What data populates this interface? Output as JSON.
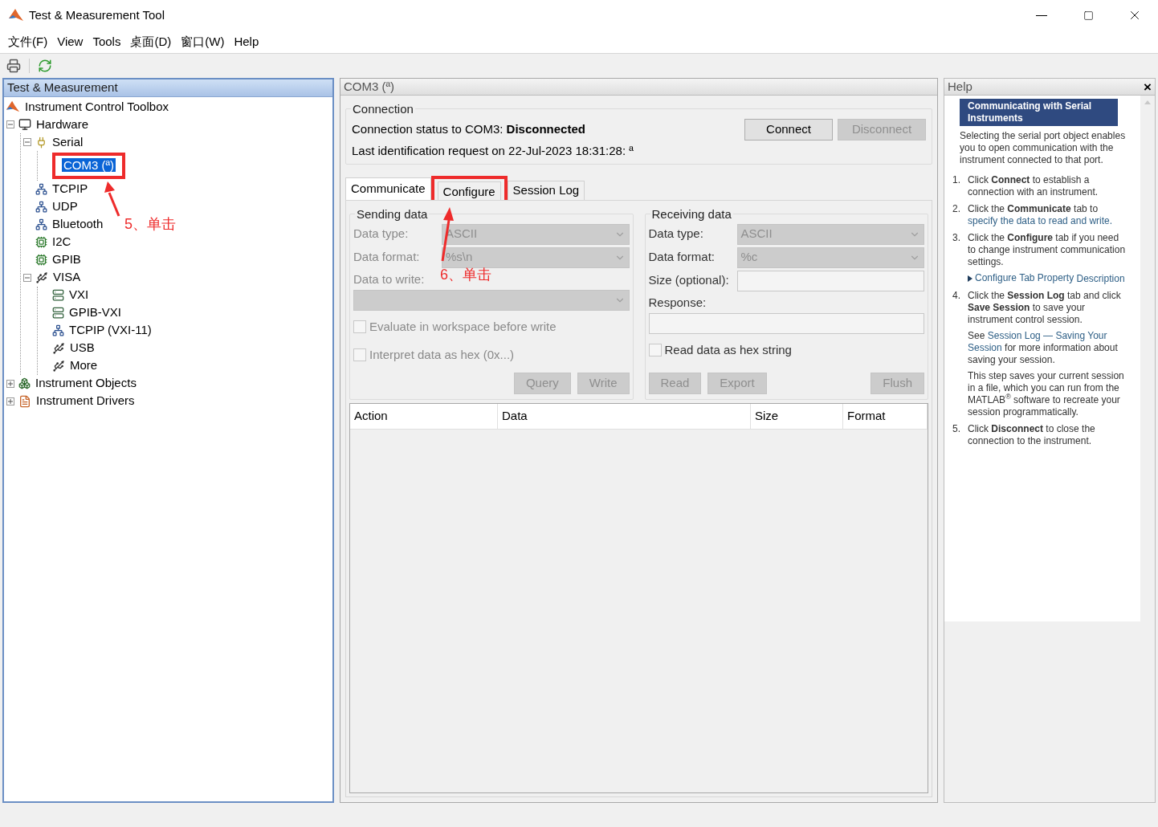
{
  "window": {
    "title": "Test & Measurement Tool"
  },
  "menu": [
    "文件(F)",
    "View",
    "Tools",
    "桌面(D)",
    "窗口(W)",
    "Help"
  ],
  "tree_panel": {
    "title": "Test & Measurement",
    "items": [
      {
        "label": "Instrument Control Toolbox",
        "kind": "toolbox",
        "selected": false,
        "children": [
          {
            "label": "Hardware",
            "kind": "hardware",
            "expanded": true,
            "selected": false,
            "children": [
              {
                "label": "Serial",
                "kind": "serial",
                "expanded": true,
                "selected": false,
                "children": [
                  {
                    "label": "COM3 (ª)",
                    "kind": "port",
                    "selected": true,
                    "highlighted": true
                  }
                ]
              },
              {
                "label": "TCPIP",
                "kind": "network",
                "selected": false
              },
              {
                "label": "UDP",
                "kind": "network",
                "selected": false
              },
              {
                "label": "Bluetooth",
                "kind": "network",
                "selected": false
              },
              {
                "label": "I2C",
                "kind": "board",
                "selected": false
              },
              {
                "label": "GPIB",
                "kind": "board",
                "selected": false
              },
              {
                "label": "VISA",
                "kind": "visa",
                "expanded": true,
                "selected": false,
                "children": [
                  {
                    "label": "VXI",
                    "kind": "card",
                    "selected": false
                  },
                  {
                    "label": "GPIB-VXI",
                    "kind": "card",
                    "selected": false
                  },
                  {
                    "label": "TCPIP (VXI-11)",
                    "kind": "network",
                    "selected": false
                  },
                  {
                    "label": "USB",
                    "kind": "visa",
                    "selected": false
                  },
                  {
                    "label": "More",
                    "kind": "visa",
                    "selected": false
                  }
                ]
              }
            ]
          },
          {
            "label": "Instrument Objects",
            "kind": "objects",
            "expanded": false,
            "selected": false
          },
          {
            "label": "Instrument Drivers",
            "kind": "drivers",
            "expanded": false,
            "selected": false
          }
        ]
      }
    ]
  },
  "device_panel": {
    "title": "COM3 (ª)",
    "connection": {
      "title": "Connection",
      "status": "Connection status to COM3: **Disconnected**",
      "last_request": "Last identification request on 22-Jul-2023 18:31:28: ª",
      "buttons": [
        {
          "label": "Connect",
          "disabled": false
        },
        {
          "label": "Disconnect",
          "disabled": true
        }
      ]
    },
    "tabs": [
      {
        "label": "Communicate",
        "selected": true,
        "highlighted": false
      },
      {
        "label": "Configure",
        "selected": false,
        "highlighted": true
      },
      {
        "label": "Session Log",
        "selected": false,
        "highlighted": false
      }
    ],
    "groups": [
      {
        "title": "Sending data",
        "disabled": true,
        "fields": [
          {
            "kind": "select",
            "label": "Data type:",
            "value": "ASCII",
            "disabled": true
          },
          {
            "kind": "select",
            "label": "Data format:",
            "value": "%s\\n",
            "disabled": true
          },
          {
            "kind": "select_below",
            "label": "Data to write:",
            "disabled": true
          }
        ],
        "checkboxes": [
          {
            "label": "Evaluate in workspace before write",
            "checked": false
          },
          {
            "label": "Interpret data as hex (0x...)",
            "checked": false
          }
        ],
        "buttons": [
          {
            "label": "Query",
            "disabled": true
          },
          {
            "label": "Write",
            "disabled": true
          }
        ]
      },
      {
        "title": "Receiving data",
        "disabled": false,
        "fields": [
          {
            "kind": "select",
            "label": "Data type:",
            "value": "ASCII",
            "disabled": true
          },
          {
            "kind": "select",
            "label": "Data format:",
            "value": "%c",
            "disabled": true
          },
          {
            "kind": "input",
            "label": "Size (optional):",
            "disabled": false
          },
          {
            "kind": "input_below",
            "label": "Response:",
            "disabled": false
          }
        ],
        "checkboxes": [
          {
            "label": "Read data as hex string",
            "checked": false
          }
        ],
        "buttons": [
          {
            "label": "Read",
            "disabled": true
          },
          {
            "label": "Export",
            "disabled": true
          },
          {
            "label": "Flush",
            "disabled": true
          }
        ]
      }
    ],
    "table": {
      "columns": [
        "Action",
        "Data",
        "Size",
        "Format"
      ]
    }
  },
  "help": {
    "title": "Help",
    "close": "×",
    "heading": "Communicating with Serial Instruments",
    "intro": "Selecting the serial port object enables you to open communication with the instrument connected to that port.",
    "steps": [
      {
        "number": "1.",
        "paragraphs": [
          [
            {
              "kind": "text",
              "text": "Click **Connect** to establish a connection with an instrument."
            }
          ]
        ]
      },
      {
        "number": "2.",
        "paragraphs": [
          [
            {
              "kind": "text",
              "text": "Click the **Communicate** tab to"
            },
            {
              "kind": "link",
              "text": "specify the data to read and"
            },
            {
              "kind": "link",
              "text": "write."
            }
          ]
        ]
      },
      {
        "number": "3.",
        "paragraphs": [
          [
            {
              "kind": "text",
              "text": "Click the **Configure** tab if you need to change instrument communication settings."
            }
          ],
          [
            {
              "kind": "expander",
              "text": "Configure Tab Property"
            },
            {
              "kind": "link",
              "text": "Description"
            }
          ]
        ]
      },
      {
        "number": "4.",
        "paragraphs": [
          [
            {
              "kind": "text",
              "text": "Click the **Session Log** tab and click **Save Session** to save your instrument control session."
            }
          ],
          [
            {
              "kind": "text",
              "text": "See"
            },
            {
              "kind": "link",
              "text": "Session Log — Saving Your"
            },
            {
              "kind": "link",
              "text": "Session"
            },
            {
              "kind": "text",
              "text": "for more information about saving your session."
            }
          ],
          [
            {
              "kind": "text",
              "text": "This step saves your current session in a file, which you can run from the MATLAB$^{®}$ software to recreate your session programmatically."
            }
          ]
        ]
      },
      {
        "number": "5.",
        "paragraphs": [
          [
            {
              "kind": "text",
              "text": "Click **Disconnect** to close the connection to the instrument."
            }
          ]
        ]
      }
    ]
  },
  "annotations": [
    {
      "text": "5、单击"
    },
    {
      "text": "6、单击"
    }
  ]
}
